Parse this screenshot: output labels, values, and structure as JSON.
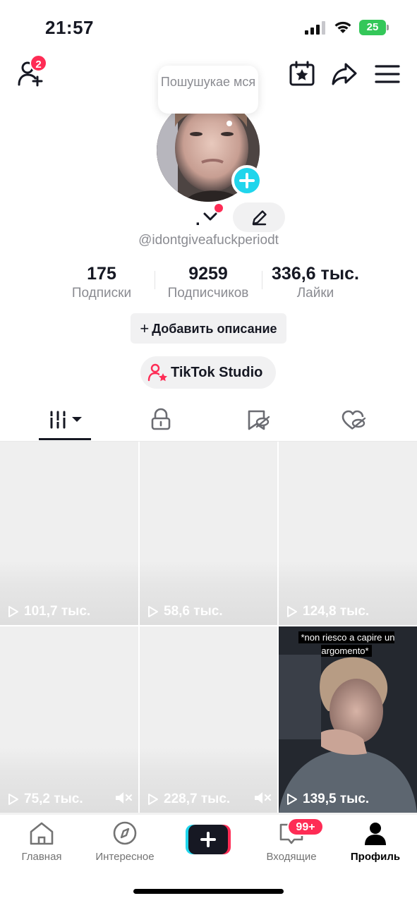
{
  "status_bar": {
    "time": "21:57",
    "battery": "25",
    "icons": [
      "signal-icon",
      "wifi-icon",
      "battery-charging-icon"
    ]
  },
  "header": {
    "friends_badge": "2",
    "icons": [
      "add-friend-icon",
      "calendar-star-icon",
      "share-icon",
      "menu-icon"
    ]
  },
  "profile": {
    "bubble_text": "Пошушукае мся",
    "display_name": ".",
    "handle": "@idontgiveafuckperiodt",
    "stats": [
      {
        "value": "175",
        "label": "Подписки"
      },
      {
        "value": "9259",
        "label": "Подписчиков"
      },
      {
        "value": "336,6 тыс.",
        "label": "Лайки"
      }
    ],
    "add_description": "Добавить описание",
    "studio_label": "TikTok Studio"
  },
  "tabs": {
    "icons": [
      "videos-grid-icon",
      "lock-icon",
      "bookmark-hidden-icon",
      "liked-hidden-icon"
    ],
    "active_index": 0
  },
  "videos": [
    {
      "views": "101,7 тыс.",
      "muted": false
    },
    {
      "views": "58,6 тыс.",
      "muted": false
    },
    {
      "views": "124,8 тыс.",
      "muted": false
    },
    {
      "views": "75,2 тыс.",
      "muted": true
    },
    {
      "views": "228,7 тыс.",
      "muted": true
    },
    {
      "views": "139,5 тыс.",
      "muted": false,
      "caption": "*non riesco a capire un argomento*"
    }
  ],
  "nav": {
    "items": [
      {
        "label": "Главная",
        "icon": "home-icon"
      },
      {
        "label": "Интересное",
        "icon": "compass-icon"
      },
      {
        "label": "",
        "icon": "create-icon"
      },
      {
        "label": "Входящие",
        "icon": "inbox-icon"
      },
      {
        "label": "Профиль",
        "icon": "profile-icon"
      }
    ],
    "inbox_badge": "99+",
    "active": "Профиль"
  },
  "colors": {
    "accent": "#fe2c55",
    "cyan": "#20d5ec",
    "battery": "#34c759"
  }
}
